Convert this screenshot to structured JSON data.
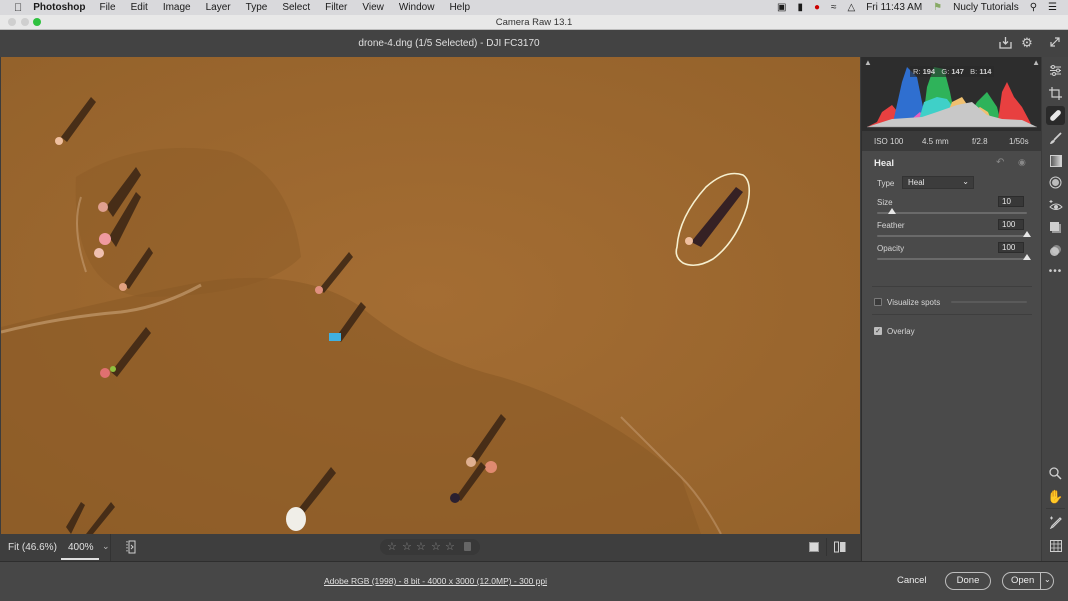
{
  "menubar": {
    "app_name": "Photoshop",
    "menus": [
      "File",
      "Edit",
      "Image",
      "Layer",
      "Type",
      "Select",
      "Filter",
      "View",
      "Window",
      "Help"
    ],
    "status_icons": [
      "camera-icon",
      "battery-icon",
      "creative-cloud-icon",
      "wifi-icon",
      "airplay-icon"
    ],
    "clock": "Fri 11:43 AM",
    "user": "Nucly Tutorials"
  },
  "window": {
    "title": "Camera Raw 13.1",
    "file_info": "drone-4.dng (1/5 Selected)  -  DJI FC3170"
  },
  "histogram": {
    "rgb_readout": {
      "r_label": "R:",
      "r": "194",
      "g_label": "G:",
      "g": "147",
      "b_label": "B:",
      "b": "114"
    },
    "exif": {
      "iso": "ISO 100",
      "focal": "4.5 mm",
      "aperture": "f/2.8",
      "shutter": "1/50s"
    }
  },
  "heal_panel": {
    "title": "Heal",
    "type_label": "Type",
    "type_value": "Heal",
    "size_label": "Size",
    "size_value": "10",
    "size_fraction": 0.1,
    "feather_label": "Feather",
    "feather_value": "100",
    "feather_fraction": 1.0,
    "opacity_label": "Opacity",
    "opacity_value": "100",
    "opacity_fraction": 1.0,
    "visualize_label": "Visualize spots",
    "visualize_checked": false,
    "overlay_label": "Overlay",
    "overlay_checked": true
  },
  "bottombar": {
    "fit_label": "Fit (46.6%)",
    "zoom_value": "400%",
    "rating_stars": 5,
    "rating_value": 0
  },
  "statusbar": {
    "workflow_link": "Adobe RGB (1998) - 8 bit - 4000 x 3000 (12.0MP) - 300 ppi",
    "cancel_label": "Cancel",
    "done_label": "Done",
    "open_label": "Open"
  },
  "colors": {
    "sand": "#a06a30",
    "panel_bg": "#4a4a4a",
    "hist_blue": "#2f6fd0",
    "hist_green": "#2fb35a",
    "hist_red": "#e84040",
    "hist_cyan": "#3fd0c8",
    "hist_yellow": "#f0c070",
    "hist_magenta": "#e860c0"
  }
}
